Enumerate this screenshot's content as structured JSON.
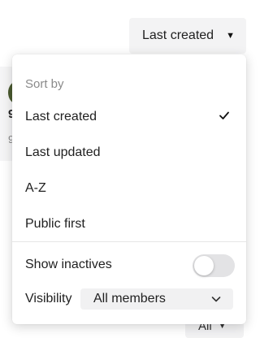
{
  "background": {
    "card_initial": "9",
    "card_subtext": "9",
    "filter_label": "All"
  },
  "sort": {
    "current_label": "Last created"
  },
  "menu": {
    "heading": "Sort by",
    "options": [
      {
        "label": "Last created",
        "selected": true
      },
      {
        "label": "Last updated",
        "selected": false
      },
      {
        "label": "A-Z",
        "selected": false
      },
      {
        "label": "Public first",
        "selected": false
      }
    ],
    "show_inactives": {
      "label": "Show inactives",
      "enabled": false
    },
    "visibility": {
      "label": "Visibility",
      "value": "All members"
    }
  },
  "icons": {
    "caret": "caret-down-icon",
    "check": "check-icon",
    "chevron": "chevron-down-icon"
  }
}
